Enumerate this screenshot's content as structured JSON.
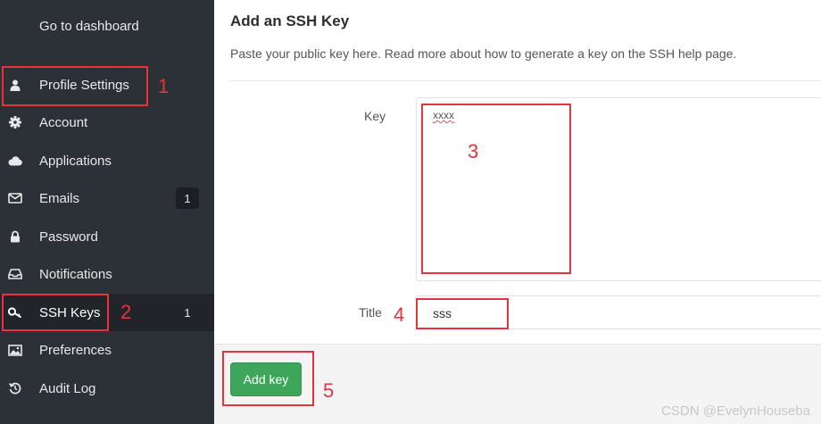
{
  "sidebar": {
    "items": [
      {
        "label": "Go to dashboard",
        "icon": "none",
        "badge": ""
      },
      {
        "label": "Profile Settings",
        "icon": "user-icon",
        "badge": ""
      },
      {
        "label": "Account",
        "icon": "gear-icon",
        "badge": ""
      },
      {
        "label": "Applications",
        "icon": "cloud-icon",
        "badge": ""
      },
      {
        "label": "Emails",
        "icon": "envelope-icon",
        "badge": "1"
      },
      {
        "label": "Password",
        "icon": "lock-icon",
        "badge": ""
      },
      {
        "label": "Notifications",
        "icon": "inbox-icon",
        "badge": ""
      },
      {
        "label": "SSH Keys",
        "icon": "key-icon",
        "badge": "1"
      },
      {
        "label": "Preferences",
        "icon": "image-icon",
        "badge": ""
      },
      {
        "label": "Audit Log",
        "icon": "history-icon",
        "badge": ""
      }
    ],
    "active_item": "SSH Keys"
  },
  "main": {
    "title": "Add an SSH Key",
    "description": "Paste your public key here. Read more about how to generate a key on the SSH help page.",
    "key_label": "Key",
    "key_value": "xxxx",
    "title_label": "Title",
    "title_value": "sss",
    "submit_label": "Add key"
  },
  "annotations": [
    "1",
    "2",
    "3",
    "4",
    "5"
  ],
  "watermark": "CSDN @EvelynHouseba",
  "colors": {
    "sidebar_bg": "#2c3137",
    "active_bg": "#212529",
    "button_green": "#3da65a",
    "annotation_red": "#e8323c"
  }
}
